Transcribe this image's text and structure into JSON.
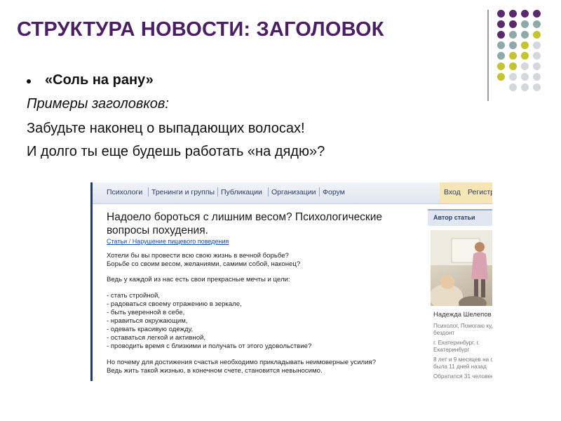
{
  "slide": {
    "title": "СТРУКТУРА НОВОСТИ: ЗАГОЛОВОК",
    "bullet_text": "«Соль на рану»",
    "lines": [
      "Примеры заголовков:",
      "Забудьте наконец о выпадающих волосах!",
      "И долго ты еще будешь работать «на дядю»?"
    ],
    "colors": {
      "title": "#4b1f63",
      "dot_purple": "#5b2a6e",
      "dot_teal": "#8eaaa8",
      "dot_olive": "#c3c42f",
      "dot_grey": "#d6d6de"
    }
  },
  "website": {
    "nav": [
      "Психологи",
      "Тренинги и группы",
      "Публикации",
      "Организации",
      "Форум"
    ],
    "nav_login": "Вход",
    "nav_register": "Регистр",
    "article_title": "Надоело бороться с лишним весом? Психологические вопросы похудения.",
    "breadcrumbs": [
      "Статьи",
      "Нарушение пищевого поведения"
    ],
    "body_lines": [
      "Хотели бы вы провести всю свою жизнь в вечной борьбе?",
      "Борьбе со своим весом, желаниями, самими собой, наконец?",
      "Ведь у каждой из нас есть свои прекрасные мечты и цели:",
      "- стать стройной,",
      "- радоваться своему отражению в зеркале,",
      "- быть уверенной в себе,",
      "- нравиться окружающим,",
      "- одевать красивую одежду,",
      "- оставаться легкой и активной,",
      "- проводить время с близкими и получать от этого удовольствие?",
      "Но почему для достижения счастья необходимо прикладывать неимоверные усилия?",
      "Ведь жить такой жизнью, в конечном счете, становится невыносимо."
    ],
    "sidebar": {
      "heading": "Автор статьи",
      "author_name": "Надежда Шелепов",
      "info": [
        "Психолог, Помогаю куд",
        "бездонт",
        "г. Екатеринбург, г.",
        "Екатеринбург",
        "8 лет и 9 месяцев на с",
        "была 11 дней назад",
        "Обратился 31 человек"
      ]
    }
  }
}
